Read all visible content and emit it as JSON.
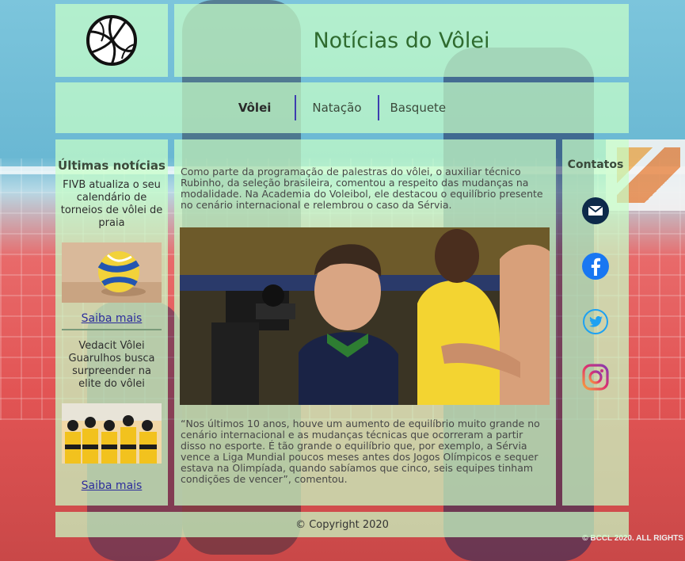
{
  "header": {
    "title": "Notícias do Vôlei",
    "logo_icon": "volleyball-icon"
  },
  "nav": {
    "items": [
      {
        "label": "Vôlei",
        "active": true
      },
      {
        "label": "Natação",
        "active": false
      },
      {
        "label": "Basquete",
        "active": false
      }
    ]
  },
  "sidebar": {
    "title": "Últimas notícias",
    "news": [
      {
        "headline": "FIVB atualiza o seu calendário de torneios de vôlei de praia",
        "link": "Saiba mais"
      },
      {
        "headline": "Vedacit Vôlei Guarulhos busca surpreender na elite do vôlei",
        "link": "Saiba mais"
      }
    ]
  },
  "article": {
    "intro": "Como parte da programação de palestras do vôlei, o auxiliar técnico Rubinho, da seleção brasileira, comentou a respeito das mudanças na modalidade. Na Academia do Voleibol, ele destacou o equilíbrio presente no cenário internacional e relembrou o caso da Sérvia.",
    "quote": "“Nos últimos 10 anos, houve um aumento de equilíbrio muito grande no cenário internacional e as mudanças técnicas que ocorreram a partir disso no esporte. É tão grande o equilíbrio que, por exemplo, a Sérvia vence a Liga Mundial poucos meses antes dos Jogos Olímpicos e sequer estava na Olimpíada, quando sabíamos que cinco, seis equipes tinham condições de vencer”, comentou."
  },
  "contacts": {
    "title": "Contatos",
    "icons": [
      "email-icon",
      "facebook-icon",
      "twitter-icon",
      "instagram-icon"
    ]
  },
  "footer": {
    "copyright": "© Copyright 2020"
  },
  "background": {
    "corner_text": "© BCCL 2020. ALL RIGHTS"
  },
  "colors": {
    "panel": "#c8ffc8",
    "title": "#2f6b2f",
    "link": "#2c2c9c",
    "nav_separator": "#3d3db0"
  }
}
